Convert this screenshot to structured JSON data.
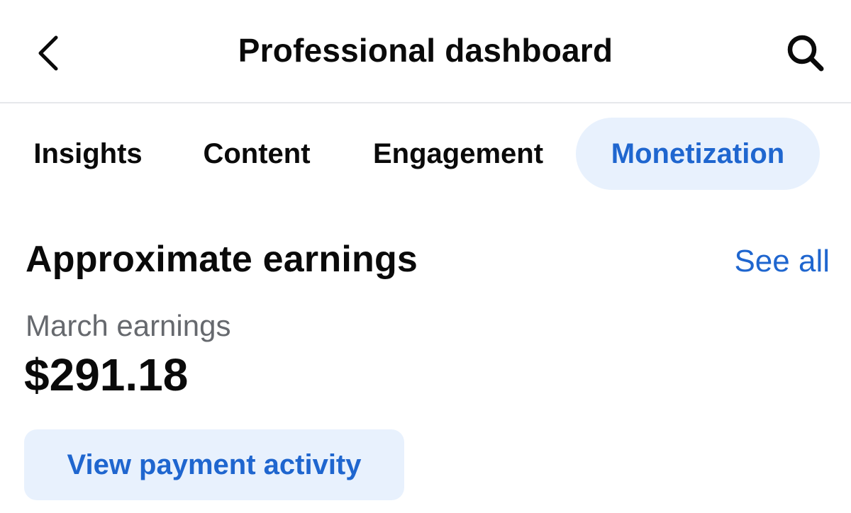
{
  "header": {
    "title": "Professional dashboard",
    "back_icon": "chevron-left-icon",
    "search_icon": "search-icon"
  },
  "tabs": [
    {
      "label": "Insights",
      "selected": false
    },
    {
      "label": "Content",
      "selected": false
    },
    {
      "label": "Engagement",
      "selected": false
    },
    {
      "label": "Monetization",
      "selected": true
    }
  ],
  "earnings": {
    "section_title": "Approximate earnings",
    "see_all_label": "See all",
    "period_label": "March earnings",
    "amount": "$291.18",
    "payment_button_label": "View payment activity"
  },
  "colors": {
    "accent": "#1f66cf",
    "accent_bg": "#e8f1fd",
    "text_primary": "#0a0a0a",
    "text_secondary": "#66696e",
    "divider": "#e6e8eb"
  }
}
